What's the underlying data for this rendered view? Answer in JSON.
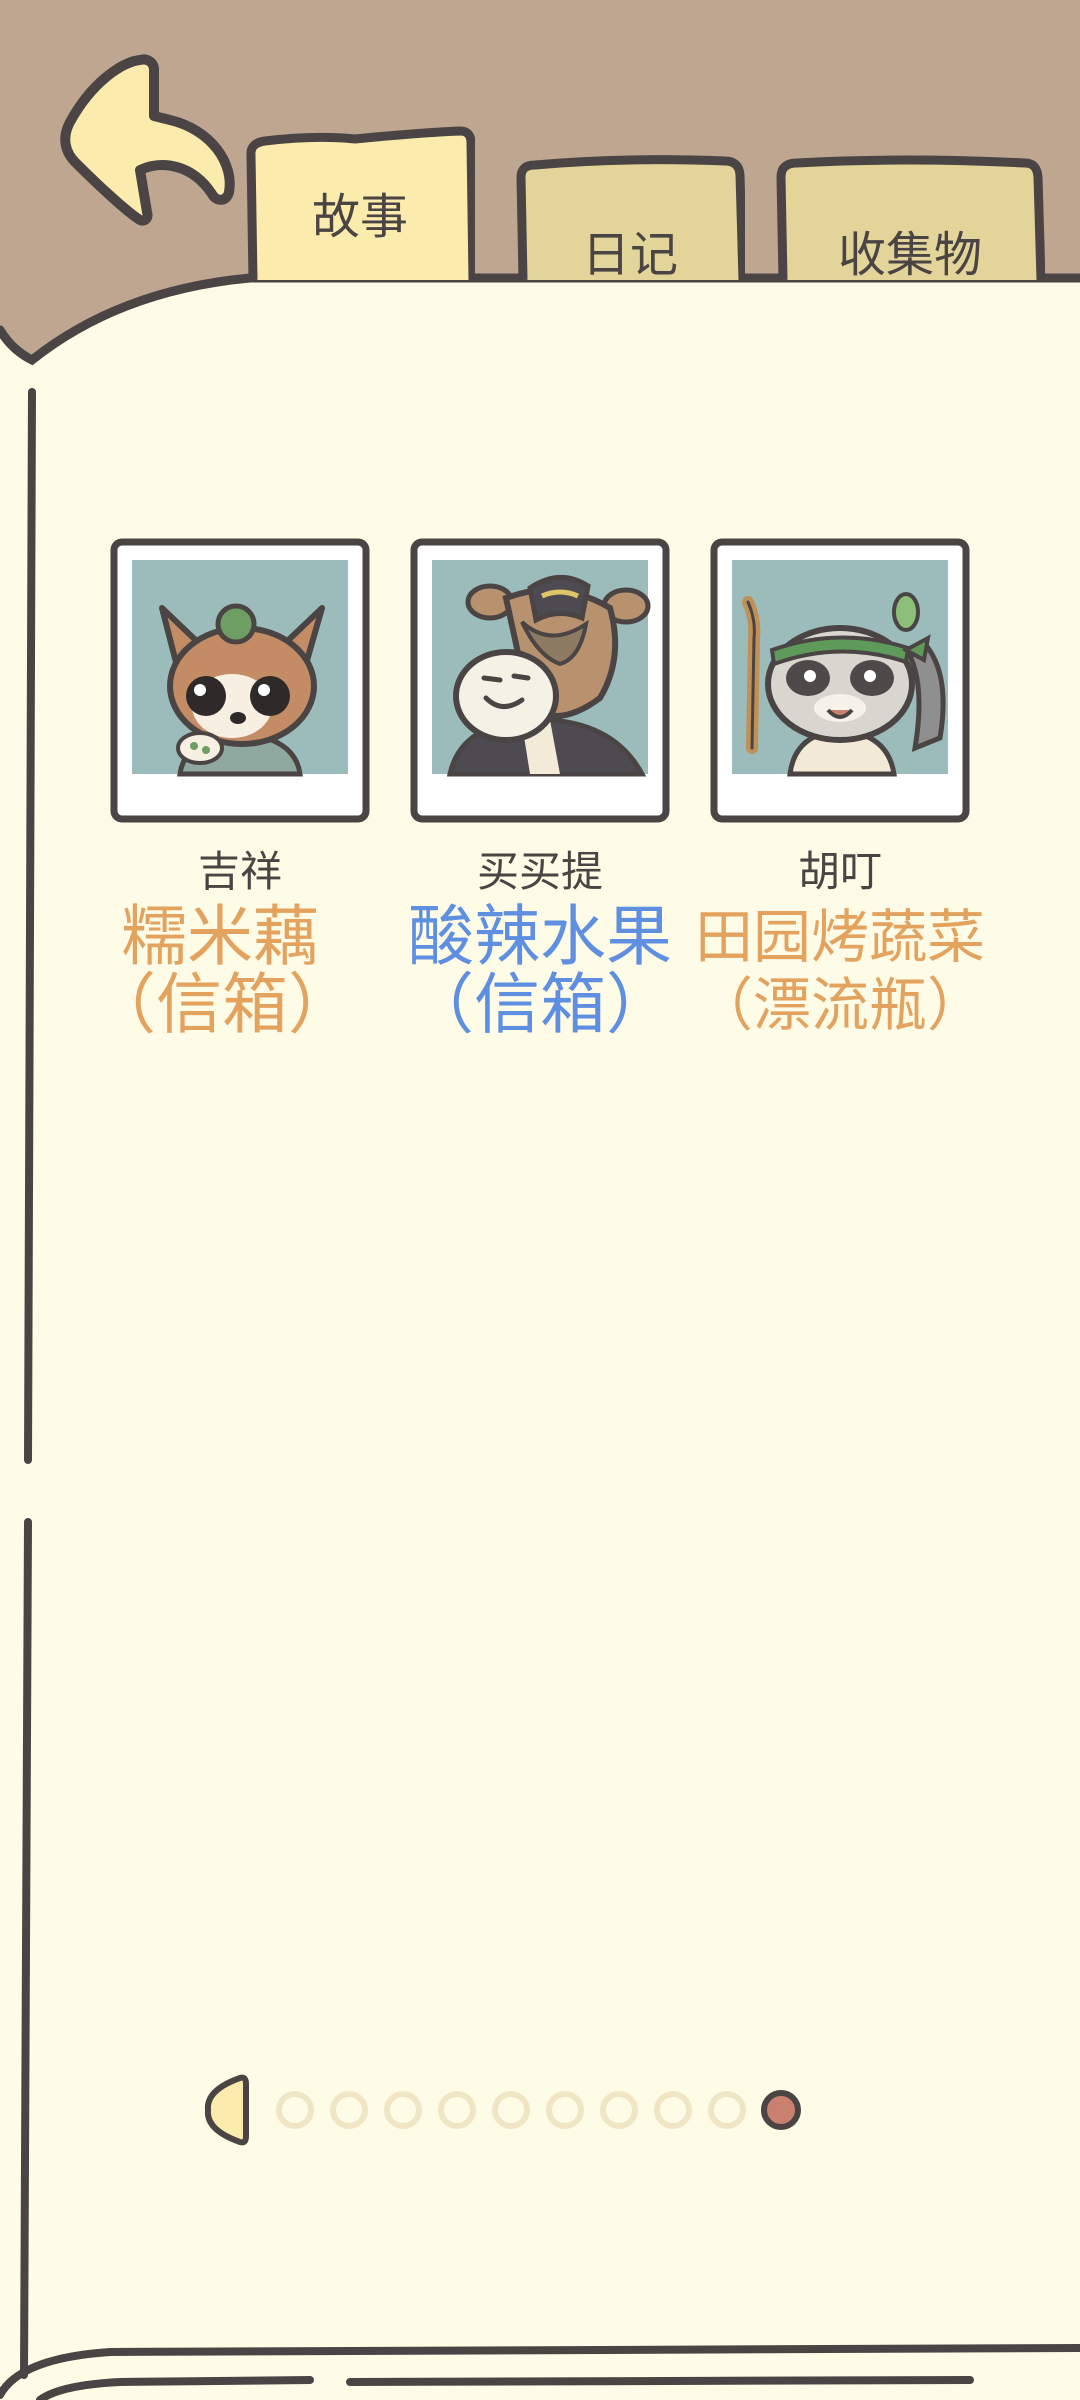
{
  "tabs": [
    {
      "label": "故事",
      "active": true
    },
    {
      "label": "日记",
      "active": false
    },
    {
      "label": "收集物",
      "active": false
    }
  ],
  "cards": [
    {
      "name": "吉祥",
      "dish_name": "糯米藕",
      "dish_source": "（信箱）",
      "dish_color": "#e3a35f",
      "portrait": "chihuahua-portrait"
    },
    {
      "name": "买买提",
      "dish_name": "酸辣水果",
      "dish_source": "（信箱）",
      "dish_color": "#5f8fe0",
      "portrait": "camel-portrait"
    },
    {
      "name": "胡叮",
      "dish_name": "田园烤蔬菜",
      "dish_source": "（漂流瓶）",
      "dish_color": "#e3a35f",
      "portrait": "raccoon-portrait"
    }
  ],
  "pagination": {
    "total_pages": 10,
    "current_page": 10
  },
  "colors": {
    "paper": "#fefbe6",
    "header": "#bfa691",
    "outline": "#4a4544",
    "tab_active": "#fbecad",
    "tab_inactive": "#e3d59a",
    "portrait_bg": "#9cbcbc",
    "dot_inactive": "#f0e6c6",
    "dot_active": "#c9806e"
  }
}
